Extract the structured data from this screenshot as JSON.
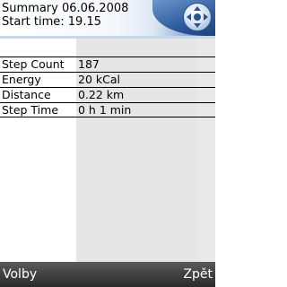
{
  "header": {
    "title": "Summary 06.06.2008",
    "start_time": "Start time: 19.15",
    "nav_icon": "navigation-pad-icon"
  },
  "stats": [
    {
      "label": "Step Count",
      "value": "187"
    },
    {
      "label": "Energy",
      "value": "20 kCal"
    },
    {
      "label": "Distance",
      "value": "0.22 km"
    },
    {
      "label": "Step Time",
      "value": "0 h 1 min"
    }
  ],
  "softkeys": {
    "left": "Volby",
    "right": "Zpět"
  },
  "colors": {
    "header_accent": "#2e5c9e",
    "value_column_bg": "#e6e6e6",
    "softkey_bar": "#3a3a3a"
  }
}
